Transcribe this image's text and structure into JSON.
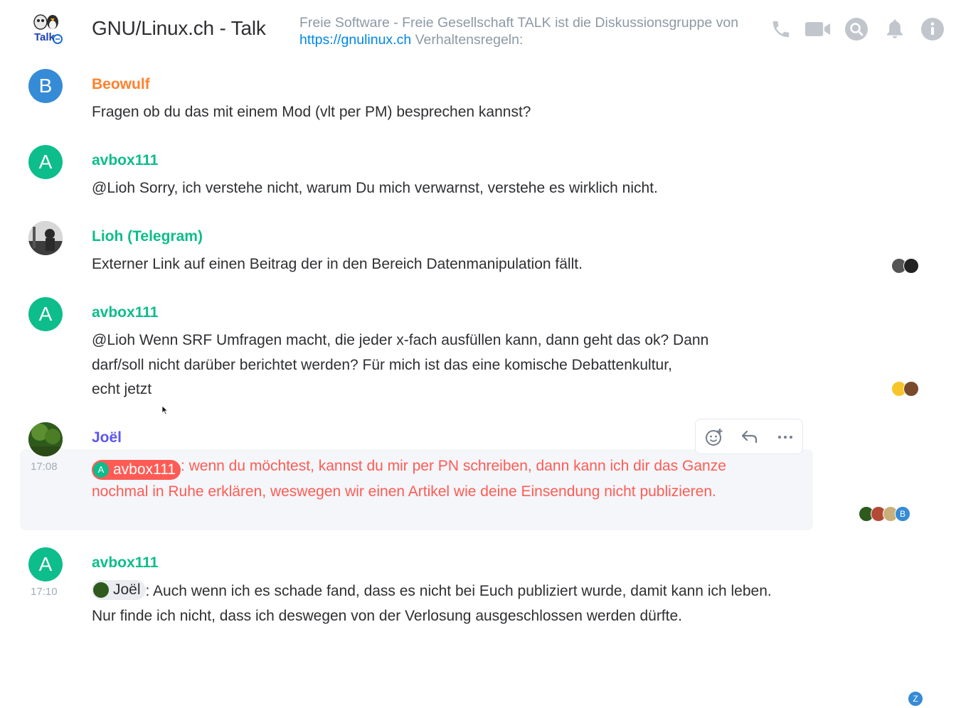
{
  "room": {
    "name": "GNU/Linux.ch - Talk",
    "avatar_text": "Talk",
    "topic_prefix": "Freie Software - Freie Gesellschaft TALK ist die Diskussionsgruppe von ",
    "topic_link": "https://gnulinux.ch",
    "topic_suffix": " Verhaltensregeln:"
  },
  "header_icons": [
    "phone-icon",
    "video-icon",
    "search-icon",
    "bell-icon",
    "info-icon"
  ],
  "messages": [
    {
      "sender": "Beowulf",
      "avatar_letter": "B",
      "body": "Fragen ob du das mit einem Mod (vlt per PM) besprechen kannst?"
    },
    {
      "sender": "avbox111",
      "avatar_letter": "A",
      "body": "@Lioh Sorry, ich verstehe nicht, warum Du mich verwarnst, verstehe es wirklich nicht."
    },
    {
      "sender": "Lioh (Telegram)",
      "body": "Externer Link auf einen Beitrag der in den Bereich Datenmanipulation fällt."
    },
    {
      "sender": "avbox111",
      "avatar_letter": "A",
      "body_line1": "@Lioh Wenn SRF Umfragen macht, die jeder x-fach ausfüllen kann, dann geht das ok? Dann",
      "body_line2": "darf/soll nicht darüber berichtet werden? Für mich ist das eine komische Debattenkultur,",
      "body_line3": "echt jetzt"
    },
    {
      "sender": "Joël",
      "timestamp": "17:08",
      "mention": "avbox111",
      "mention_letter": "A",
      "body": ": wenn du möchtest, kannst du mir per PN schreiben, dann kann ich dir das Ganze nochmal in Ruhe erklären, weswegen wir einen Artikel wie deine Einsendung nicht publizieren."
    },
    {
      "sender": "avbox111",
      "avatar_letter": "A",
      "timestamp": "17:10",
      "mention": "Joël",
      "body": ": Auch wenn ich es schade fand, dass es nicht bei Euch publiziert wurde, damit kann ich leben. Nur finde ich nicht, dass ich deswegen von der Verlosung ausgeschlossen werden dürfte."
    }
  ],
  "receipts": {
    "joel_b_letter": "B",
    "last_z_letter": "Z"
  },
  "message_actions": [
    "react-icon",
    "reply-icon",
    "options-icon"
  ],
  "colors": {
    "beowulf": "#ff812d",
    "avbox": "#0dbd8b",
    "joel": "#5c56f5",
    "highlight": "#ff5b55",
    "avatar_b": "#368bd6",
    "avatar_a": "#0dbd8b",
    "link": "#0086e6"
  }
}
